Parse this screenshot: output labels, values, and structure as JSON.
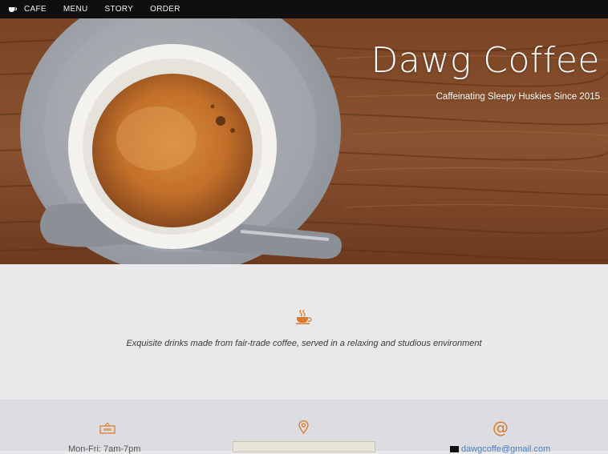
{
  "nav": {
    "brand_icon": "coffee-cup-icon",
    "items": [
      {
        "label": "CAFE"
      },
      {
        "label": "MENU"
      },
      {
        "label": "STORY"
      },
      {
        "label": "ORDER"
      }
    ]
  },
  "hero": {
    "title": "Dawg Coffee",
    "subtitle": "Caffeinating Sleepy Huskies Since 2015"
  },
  "mission": {
    "icon": "coffee-cup-icon",
    "text": "Exquisite drinks made from fair-trade coffee, served in a relaxing and studious environment"
  },
  "info": {
    "hours_icon": "open-sign-icon",
    "hours": "Mon-Fri: 7am-7pm",
    "location_icon": "map-pin-icon",
    "contact_icon": "at-sign-icon",
    "email": "dawgcoffe@gmail.com"
  },
  "colors": {
    "accent": "#d9792a",
    "navbar": "#0f0f10",
    "link": "#4a7fbd"
  }
}
